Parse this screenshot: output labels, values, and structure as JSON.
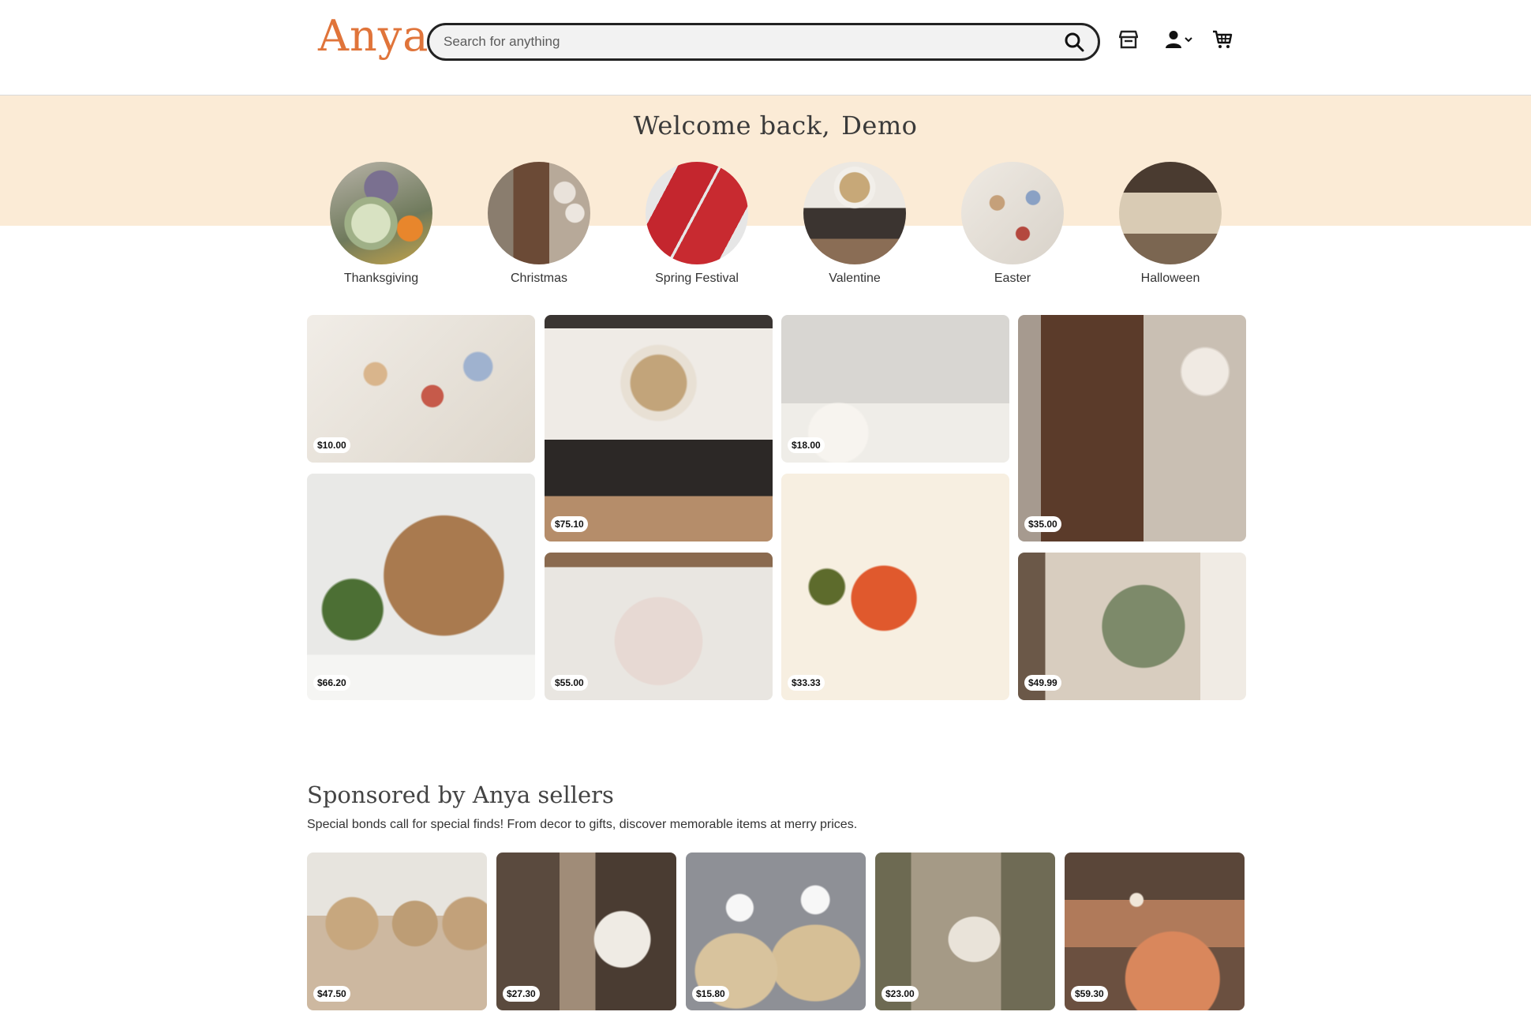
{
  "header": {
    "logo": "Anya",
    "search_placeholder": "Search for anything",
    "icons": [
      "search-icon",
      "shop-icon",
      "user-icon",
      "chevron-down-icon",
      "cart-icon"
    ]
  },
  "welcome": {
    "greeting": "Welcome back,",
    "name": "Demo"
  },
  "categories": [
    {
      "label": "Thanksgiving"
    },
    {
      "label": "Christmas"
    },
    {
      "label": "Spring Festival"
    },
    {
      "label": "Valentine"
    },
    {
      "label": "Easter"
    },
    {
      "label": "Halloween"
    }
  ],
  "grid": [
    {
      "price": "$10.00"
    },
    {
      "price": "$75.10"
    },
    {
      "price": "$18.00"
    },
    {
      "price": "$35.00"
    },
    {
      "price": "$66.20"
    },
    {
      "price": "$55.00"
    },
    {
      "price": "$33.33"
    },
    {
      "price": "$49.99"
    }
  ],
  "sponsored": {
    "title": "Sponsored by Anya sellers",
    "subtitle": "Special bonds call for special finds! From decor to gifts, discover memorable items at merry prices.",
    "items": [
      {
        "price": "$47.50"
      },
      {
        "price": "$27.30"
      },
      {
        "price": "$15.80"
      },
      {
        "price": "$23.00"
      },
      {
        "price": "$59.30"
      }
    ]
  },
  "colors": {
    "brand": "#e0743a",
    "banner": "#fbebd6"
  }
}
